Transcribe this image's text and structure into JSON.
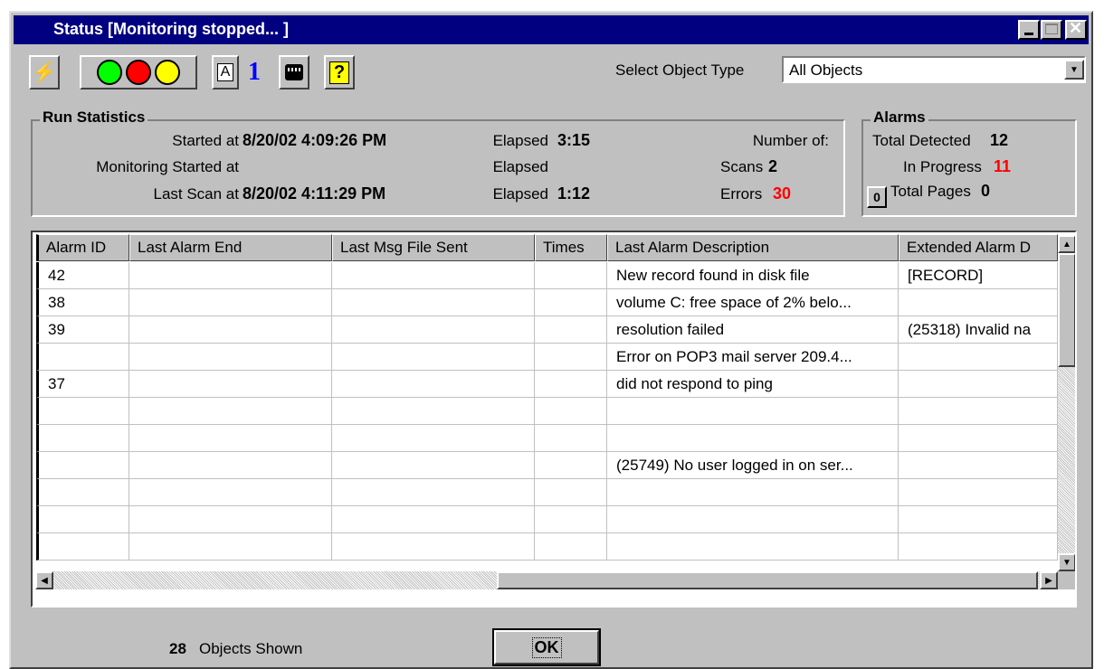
{
  "window": {
    "title": "Status [Monitoring stopped... ]"
  },
  "toolbar": {
    "select_label": "Select Object Type",
    "select_value": "All Objects",
    "number_glyph": "1",
    "letter_glyph": "A",
    "help_glyph": "?"
  },
  "run_stats": {
    "legend": "Run Statistics",
    "started_label": "Started at",
    "started_value": "8/20/02 4:09:26 PM",
    "monitoring_label": "Monitoring Started at",
    "last_scan_label": "Last Scan at",
    "last_scan_value": "8/20/02 4:11:29 PM",
    "elapsed1_label": "Elapsed",
    "elapsed1_value": "3:15",
    "elapsed2_label": "Elapsed",
    "elapsed3_label": "Elapsed",
    "elapsed3_value": "1:12",
    "number_of_label": "Number of:",
    "scans_label": "Scans",
    "scans_value": "2",
    "errors_label": "Errors",
    "errors_value": "30"
  },
  "alarms": {
    "legend": "Alarms",
    "total_label": "Total Detected",
    "total_value": "12",
    "progress_label": "In Progress",
    "progress_value": "11",
    "pages_button": "0",
    "pages_label": "Total Pages",
    "pages_value": "0"
  },
  "table": {
    "columns": [
      "Alarm ID",
      "Last Alarm End",
      "Last Msg File Sent",
      "Times",
      "Last Alarm Description",
      "Extended Alarm D"
    ],
    "rows": [
      [
        "42",
        "",
        "",
        "",
        "New record found in disk file",
        "[RECORD]"
      ],
      [
        "38",
        "",
        "",
        "",
        "volume C: free space of 2% belo...",
        ""
      ],
      [
        "39",
        "",
        "",
        "",
        "resolution failed",
        "(25318) Invalid na"
      ],
      [
        "",
        "",
        "",
        "",
        "Error on POP3 mail server 209.4...",
        ""
      ],
      [
        "37",
        "",
        "",
        "",
        "did not respond to ping",
        ""
      ],
      [
        "",
        "",
        "",
        "",
        "",
        ""
      ],
      [
        "",
        "",
        "",
        "",
        "",
        ""
      ],
      [
        "",
        "",
        "",
        "",
        "(25749) No user logged in on ser...",
        ""
      ],
      [
        "",
        "",
        "",
        "",
        "",
        ""
      ],
      [
        "",
        "",
        "",
        "",
        "",
        ""
      ],
      [
        "",
        "",
        "",
        "",
        "",
        ""
      ]
    ]
  },
  "footer": {
    "count": "28",
    "count_label": "Objects Shown",
    "ok_label": "OK"
  },
  "colors": {
    "title_bar": "#000080",
    "alert": "#ff0000",
    "status_green": "#00ff00",
    "status_red": "#ff0000",
    "status_yellow": "#ffff00",
    "number_blue": "#0000ff"
  }
}
